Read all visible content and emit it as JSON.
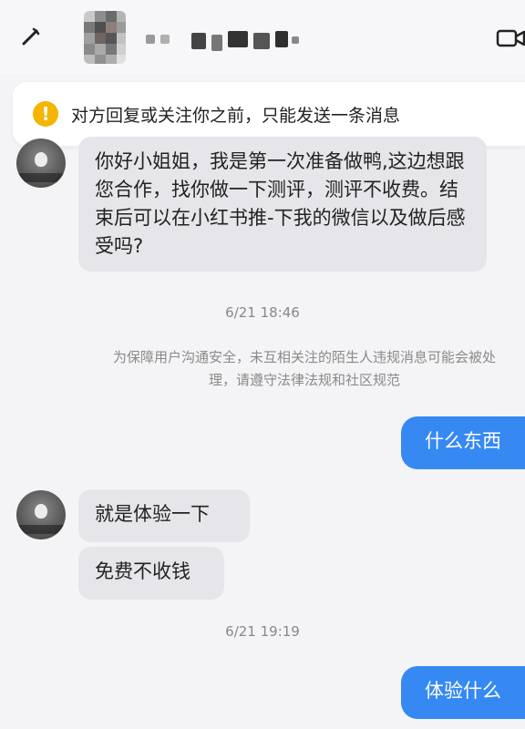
{
  "header": {
    "contact_name": "",
    "icons": {
      "back": "back-pencil-icon",
      "video": "video-call-icon"
    }
  },
  "notice": {
    "icon": "warning-icon",
    "text": "对方回复或关注你之前，只能发送一条消息"
  },
  "messages": [
    {
      "side": "left",
      "text": "你好小姐姐，我是第一次准备做鸭,这边想跟您合作，找你做一下测评，测评不收费。结束后可以在小红书推-下我的微信以及做后感受吗?"
    },
    {
      "side": "right",
      "text": "什么东西"
    },
    {
      "side": "left",
      "text": "就是体验一下"
    },
    {
      "side": "left",
      "text": "免费不收钱"
    },
    {
      "side": "right",
      "text": "体验什么"
    }
  ],
  "timestamps": [
    "6/21 18:46",
    "6/21 19:19"
  ],
  "system_notice": {
    "line1": "为保障用户沟通安全，未互相关注的陌生人违规消息可能会被处",
    "line2": "理，请遵守法律法规和社区规范"
  },
  "colors": {
    "outgoing_bubble": "#3689f3",
    "incoming_bubble": "#e6e6ea",
    "warning": "#f5b400",
    "background": "#f4f4f6"
  }
}
